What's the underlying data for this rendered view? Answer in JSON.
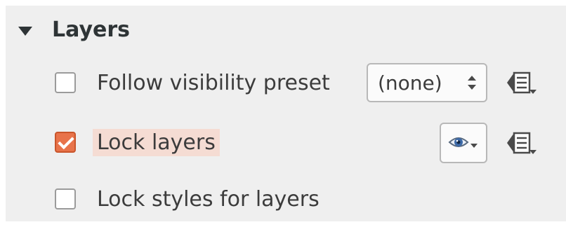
{
  "group": {
    "title": "Layers",
    "collapse_icon": "triangle-down-icon"
  },
  "rows": {
    "follow_preset": {
      "label": "Follow visibility preset",
      "checked": false,
      "combo_value": "(none)"
    },
    "lock_layers": {
      "label": "Lock layers",
      "checked": true,
      "eye_icon": "eye-dropdown-icon"
    },
    "lock_styles": {
      "label": "Lock styles for layers",
      "checked": false
    }
  },
  "icons": {
    "layer_list_menu": "layer-list-menu-icon"
  },
  "colors": {
    "panel_bg": "#efefef",
    "check_accent": "#e8734a",
    "highlight": "#f5dcd3"
  }
}
